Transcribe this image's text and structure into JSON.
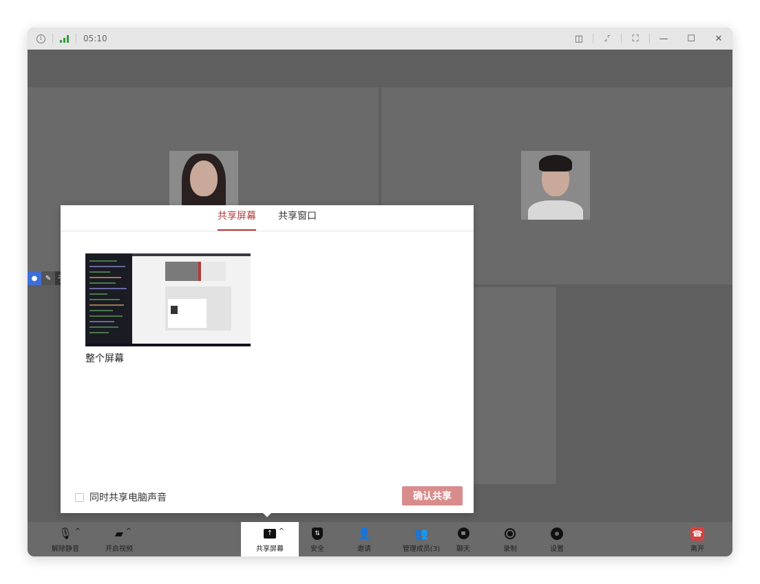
{
  "titlebar": {
    "info_icon": "i",
    "elapsed": "05:10",
    "signal_color": "#2e9e3a",
    "buttons": [
      "layout-icon",
      "exit-fullscreen-icon",
      "fullscreen-icon",
      "minimize-icon",
      "maximize-icon",
      "close-icon"
    ],
    "glyphs": {
      "layout": "◫",
      "collapse": "⌟⌜",
      "fullscreen": "⛶",
      "minimize": "—",
      "maximize": "☐",
      "close": "✕"
    }
  },
  "participants": {
    "name_chip_text": "于"
  },
  "dialog": {
    "tabs": [
      {
        "label": "共享屏幕",
        "active": true
      },
      {
        "label": "共享窗口",
        "active": false
      }
    ],
    "source_label": "整个屏幕",
    "share_audio_label": "同时共享电脑声音",
    "confirm_label": "确认共享",
    "accent_color": "#b23a3a",
    "confirm_color": "#d98c8c"
  },
  "toolbar": {
    "unmute": "解除静音",
    "start_video": "开启视频",
    "share_screen": "共享屏幕",
    "security": "安全",
    "invite": "邀请",
    "manage_members": "管理成员(3)",
    "chat": "聊天",
    "record": "录制",
    "settings": "设置",
    "leave": "离开",
    "caret": "^"
  }
}
